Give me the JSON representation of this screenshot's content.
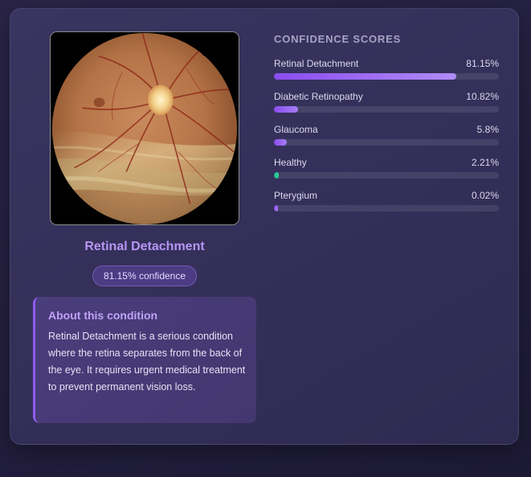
{
  "diagnosis": {
    "title": "Retinal Detachment",
    "confidence_label": "81.15% confidence"
  },
  "about": {
    "title": "About this condition",
    "text": "Retinal Detachment is a serious condition where the retina separates from the back of the eye. It requires urgent medical treatment to prevent permanent vision loss."
  },
  "scores": {
    "heading": "CONFIDENCE SCORES",
    "items": [
      {
        "label": "Retinal Detachment",
        "value_text": "81.15%",
        "value": 81.15,
        "color_start": "#8b4cf0",
        "color_end": "#b08cf7"
      },
      {
        "label": "Diabetic Retinopathy",
        "value_text": "10.82%",
        "value": 10.82,
        "color_start": "#8b4cf0",
        "color_end": "#a57ef5"
      },
      {
        "label": "Glaucoma",
        "value_text": "5.8%",
        "value": 5.8,
        "color_start": "#8b4cf0",
        "color_end": "#a57ef5"
      },
      {
        "label": "Healthy",
        "value_text": "2.21%",
        "value": 2.21,
        "color_start": "#1fb88a",
        "color_end": "#2fd69f"
      },
      {
        "label": "Pterygium",
        "value_text": "0.02%",
        "value": 0.02,
        "color_start": "#8b4cf0",
        "color_end": "#a57ef5"
      }
    ]
  }
}
